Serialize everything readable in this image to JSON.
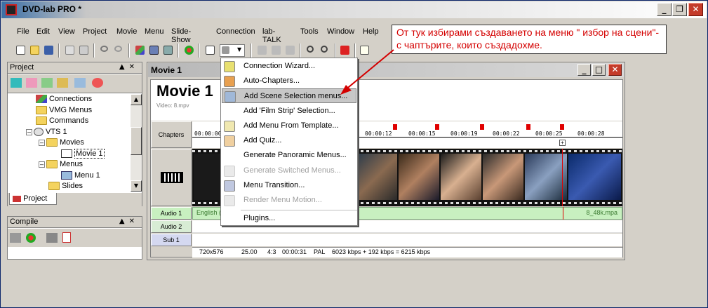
{
  "window": {
    "title": "DVD-lab PRO *"
  },
  "menubar": [
    "File",
    "Edit",
    "View",
    "Project",
    "Movie",
    "Menu",
    "Slide-Show",
    "Connection",
    "lab-TALK",
    "Tools",
    "Window",
    "Help"
  ],
  "project_panel": {
    "title": "Project",
    "tree": [
      {
        "label": "Connections",
        "icon": "connections-icon"
      },
      {
        "label": "VMG Menus",
        "icon": "folder-icon"
      },
      {
        "label": "Commands",
        "icon": "folder-icon"
      },
      {
        "label": "VTS 1",
        "icon": "vts-icon"
      },
      {
        "label": "Movies",
        "icon": "folder-icon"
      },
      {
        "label": "Movie 1",
        "icon": "movie-icon"
      },
      {
        "label": "Menus",
        "icon": "folder-icon"
      },
      {
        "label": "Menu 1",
        "icon": "menu-icon"
      },
      {
        "label": "Slides",
        "icon": "folder-icon"
      }
    ],
    "tab_label": "Project"
  },
  "compile_panel": {
    "title": "Compile"
  },
  "movie_window": {
    "title": "Movie 1",
    "heading": "Movie 1",
    "subheading": "Video: 8.mpv",
    "tracks": {
      "chapters": "Chapters",
      "audio1": "Audio 1",
      "audio2": "Audio 2",
      "sub1": "Sub 1"
    },
    "ruler_ticks": [
      "00:00:00",
      "00:00:12",
      "00:00:15",
      "00:00:19",
      "00:00:22",
      "00:00:25",
      "00:00:28"
    ],
    "audio_left": "English (",
    "audio_right": "8_48k.mpa",
    "status": {
      "resolution": "720x576",
      "fps": "25.00",
      "aspect": "4:3",
      "duration": "00:00:31",
      "standard": "PAL",
      "bitrate": "6023 kbps + 192 kbps = 6215 kbps"
    }
  },
  "dropdown": {
    "items": [
      {
        "label": "Connection Wizard...",
        "disabled": false,
        "icon": "wizard-icon"
      },
      {
        "label": "Auto-Chapters...",
        "disabled": false,
        "icon": "auto-chapters-icon"
      },
      {
        "label": "Add Scene Selection menus...",
        "disabled": false,
        "highlighted": true,
        "icon": "scene-menu-icon"
      },
      {
        "label": "Add 'Film Strip' Selection...",
        "disabled": false,
        "icon": "film-strip-icon"
      },
      {
        "label": "Add Menu From Template...",
        "disabled": false,
        "icon": "template-icon"
      },
      {
        "label": "Add Quiz...",
        "disabled": false,
        "icon": "quiz-icon"
      },
      {
        "label": "Generate Panoramic Menus...",
        "disabled": false,
        "icon": "panoramic-icon"
      },
      {
        "label": "Generate Switched Menus...",
        "disabled": true,
        "icon": "switched-icon"
      },
      {
        "label": "Menu Transition...",
        "disabled": false,
        "icon": "transition-icon"
      },
      {
        "label": "Render Menu Motion...",
        "disabled": true,
        "icon": "render-icon"
      },
      {
        "label": "Plugins...",
        "disabled": false,
        "icon": "plugins-icon"
      }
    ]
  },
  "annotation": {
    "text": "От тук избирами създаването на меню \" избор на сцени\"- с чаптърите, които създадохме."
  },
  "colors": {
    "accent": "#d40000",
    "audio_track": "#c8f0c0",
    "highlight": "#c7c7c7"
  }
}
